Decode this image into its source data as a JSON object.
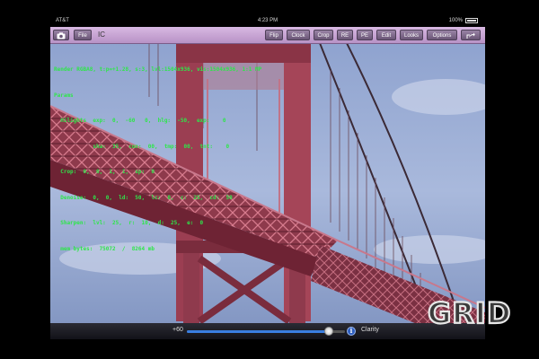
{
  "status_bar": {
    "carrier": "AT&T",
    "time": "4:23 PM",
    "battery": "100%"
  },
  "toolbar": {
    "title": "IC",
    "file_label": "File",
    "buttons": [
      "Flip",
      "Clock",
      "Crop",
      "RE",
      "PE",
      "Edit",
      "Looks",
      "Options"
    ]
  },
  "overlay_lines": [
    "Render RGBA8, t:p=+1.28, s:3, lvl:1504x936, vis:1504x936, 1:1 MP",
    "Params",
    "  Hilights  exp:  0,  -60   0,  hlg:  -50,  exp:    0",
    "            sha:  35,  con:  00,  tmp:  00,  tnt:    0",
    "  Crop:  0,  0,  1,  1,  sp:  0",
    "  Denoise:  0,  0,  ld:  50,  lc:  0,  c:  25,  cd:  50",
    "  Sharpen:  lvl:  25,  r:  10,  d:  25,  e:  0",
    "  mem bytes:  75072  /  8264 mb"
  ],
  "slider": {
    "value_label": "+60",
    "position_fraction": 0.9,
    "label": "Clarity"
  },
  "watermark": "GRID"
}
